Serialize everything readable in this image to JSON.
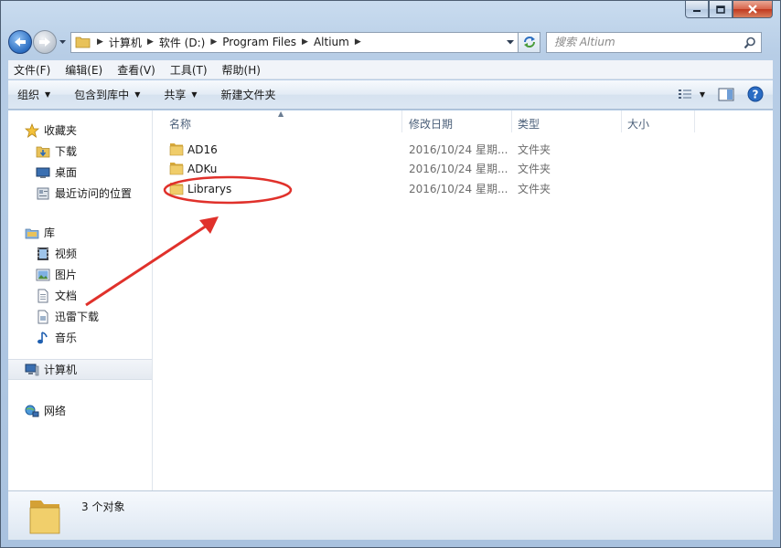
{
  "window": {
    "caption": {
      "minimize": "minimize",
      "maximize": "maximize",
      "close": "close"
    }
  },
  "address_bar": {
    "crumbs": [
      "计算机",
      "软件 (D:)",
      "Program Files",
      "Altium"
    ],
    "search_placeholder": "搜索 Altium"
  },
  "menubar": {
    "items": [
      "文件(F)",
      "编辑(E)",
      "查看(V)",
      "工具(T)",
      "帮助(H)"
    ]
  },
  "commandbar": {
    "organize": "组织",
    "include_in_library": "包含到库中",
    "share": "共享",
    "new_folder": "新建文件夹"
  },
  "nav_pane": {
    "favorites": {
      "label": "收藏夹",
      "items": [
        "下载",
        "桌面",
        "最近访问的位置"
      ]
    },
    "libraries": {
      "label": "库",
      "items": [
        "视频",
        "图片",
        "文档",
        "迅雷下载",
        "音乐"
      ]
    },
    "computer": {
      "label": "计算机"
    },
    "network": {
      "label": "网络"
    }
  },
  "file_list": {
    "columns": [
      "名称",
      "修改日期",
      "类型",
      "大小"
    ],
    "rows": [
      {
        "name": "AD16",
        "date": "2016/10/24 星期...",
        "type": "文件夹"
      },
      {
        "name": "ADKu",
        "date": "2016/10/24 星期...",
        "type": "文件夹"
      },
      {
        "name": "Librarys",
        "date": "2016/10/24 星期...",
        "type": "文件夹"
      }
    ]
  },
  "status": {
    "text": "3 个对象"
  },
  "colors": {
    "annotation_red": "#e0312b",
    "window_frame": "#b7cde6",
    "folder": "#e8c25a"
  }
}
